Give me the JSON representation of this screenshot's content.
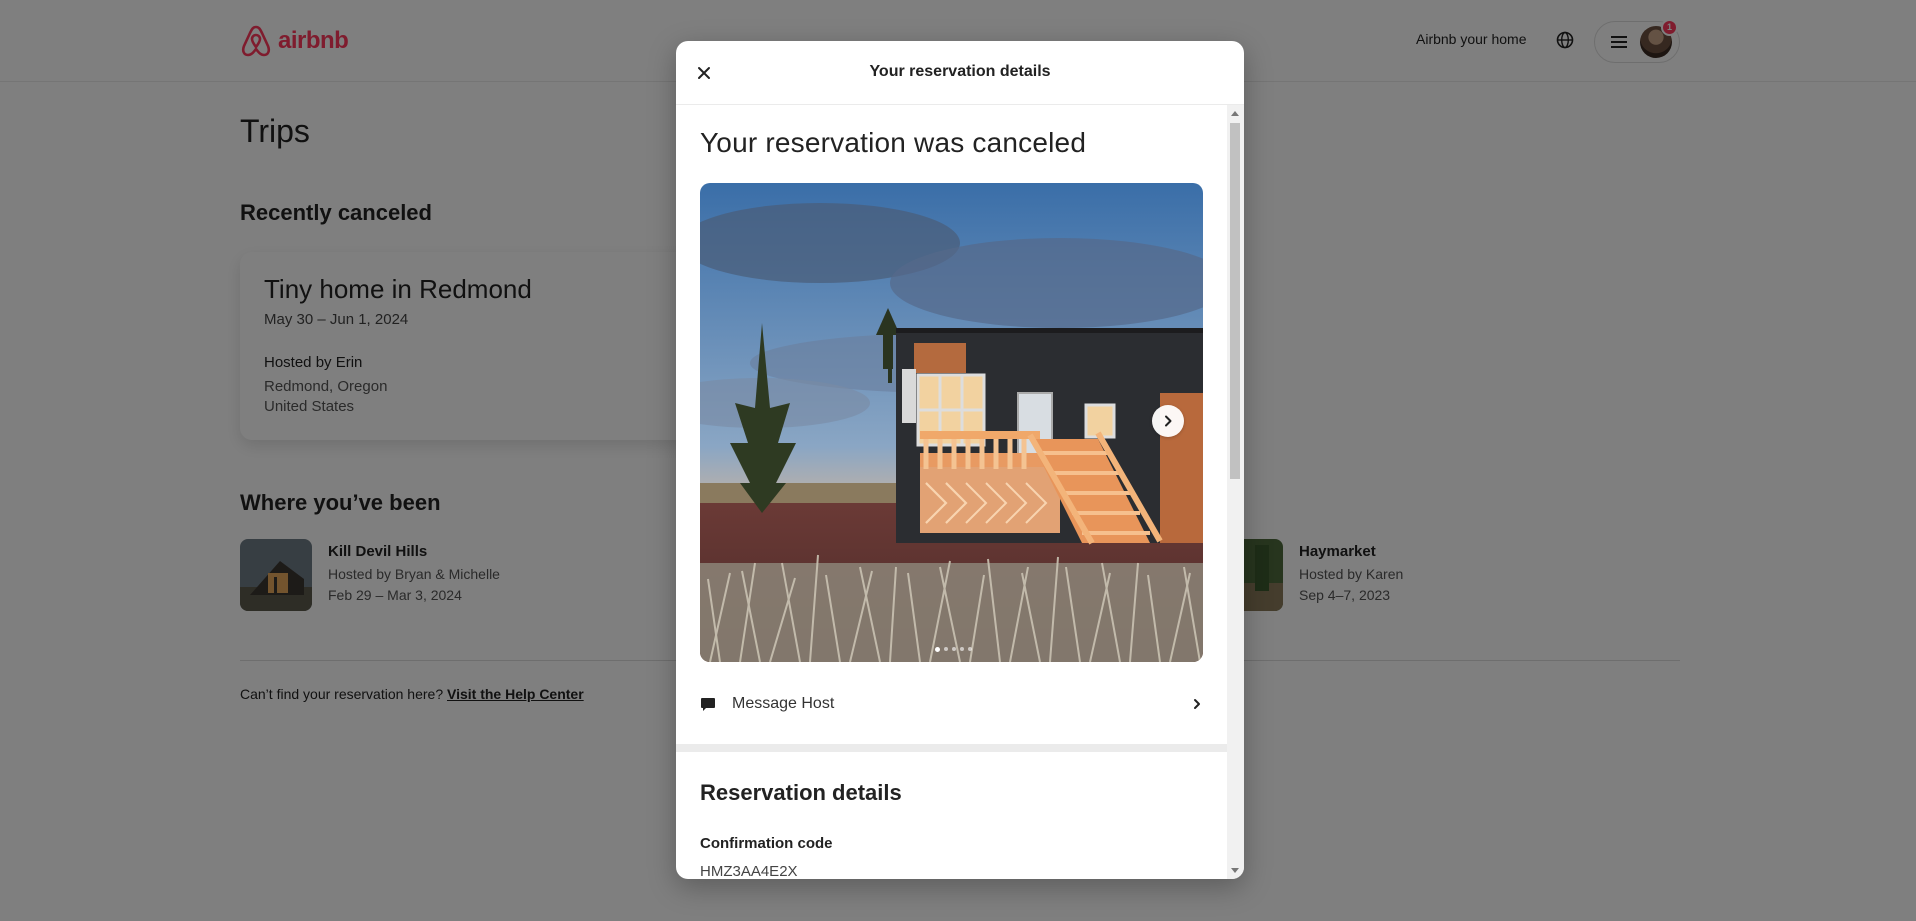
{
  "header": {
    "logo_text": "airbnb",
    "host_link": "Airbnb your home",
    "notification_count": "1",
    "brand_color": "#ff385c"
  },
  "trips": {
    "title": "Trips",
    "recently_canceled_heading": "Recently canceled",
    "canceled_card": {
      "title": "Tiny home in Redmond",
      "dates": "May 30 – Jun 1, 2024",
      "host": "Hosted by Erin",
      "location_line1": "Redmond, Oregon",
      "location_line2": "United States"
    },
    "where_been_heading": "Where you’ve been",
    "past_trips": [
      {
        "name": "Kill Devil Hills",
        "host": "Hosted by Bryan & Michelle",
        "dates": "Feb 29 – Mar 3, 2024"
      },
      {
        "name": "Haymarket",
        "host": "Hosted by Karen",
        "dates": "Sep 4–7, 2023"
      }
    ],
    "help_text": "Can’t find your reservation here?",
    "help_link": "Visit the Help Center"
  },
  "modal": {
    "title": "Your reservation details",
    "heading": "Your reservation was canceled",
    "photo_count": 5,
    "active_photo_index": 0,
    "message_host_label": "Message Host",
    "details_heading": "Reservation details",
    "confirmation_label": "Confirmation code",
    "confirmation_code": "HMZ3AA4E2X"
  },
  "icons": {
    "close": "close-icon",
    "next": "chevron-right-icon",
    "message": "message-icon",
    "globe": "globe-icon",
    "menu": "hamburger-icon"
  }
}
